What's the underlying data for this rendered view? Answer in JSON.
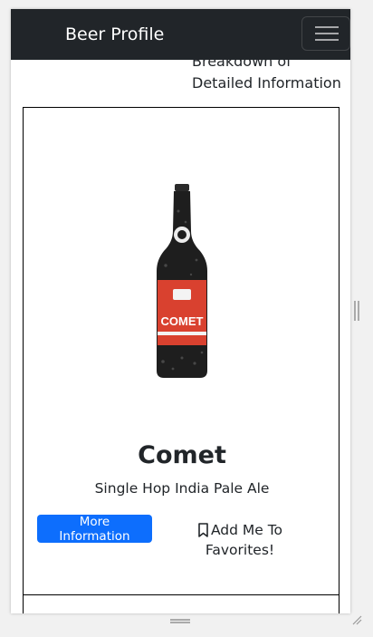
{
  "navbar": {
    "brand": "Beer Profile",
    "menu_icon": "hamburger-icon"
  },
  "previous_card": {
    "description_tail": "Breakdown of Detailed Information"
  },
  "beer": {
    "name": "Comet",
    "tagline": "Single Hop India Pale Ale",
    "label_text": "COMET",
    "more_button": "More Information",
    "favorite_label": "Add Me To Favorites!",
    "favorite_icon": "bookmark-icon"
  },
  "colors": {
    "navbar_bg": "#212529",
    "primary_button": "#0d6efd",
    "bottle_label": "#d9412f"
  }
}
